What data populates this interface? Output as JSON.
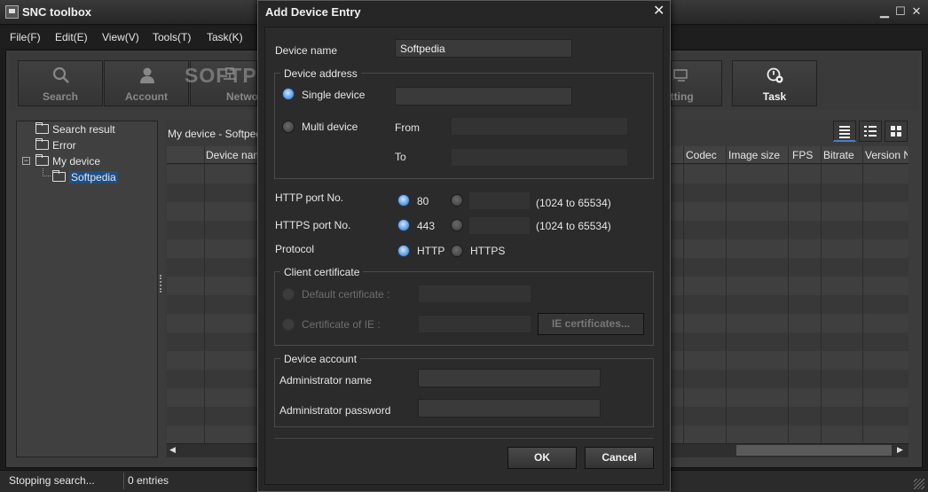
{
  "window": {
    "title": "SNC toolbox",
    "min": "▁",
    "max": "☐",
    "close": "✕"
  },
  "menu": [
    "File(F)",
    "Edit(E)",
    "View(V)",
    "Tools(T)",
    "Task(K)"
  ],
  "toolbar": {
    "search": "Search",
    "account": "Account",
    "network": "Network",
    "setting": "Setting",
    "task": "Task",
    "watermark": "SOFTPEDIA"
  },
  "tree": {
    "search_result": "Search result",
    "error": "Error",
    "my_device": "My device",
    "softpedia": "Softpedia",
    "expander": "−"
  },
  "breadcrumb": "My device - Softpedia",
  "columns": {
    "device_name": "Device name",
    "codec": "Codec",
    "image_size": "Image size",
    "fps": "FPS",
    "bitrate": "Bitrate",
    "version": "Version N"
  },
  "status": {
    "left": "Stopping search...",
    "count": "0 entries"
  },
  "dialog": {
    "title": "Add Device Entry",
    "close": "✕",
    "device_name_label": "Device name",
    "device_name_value": "Softpedia",
    "device_address_legend": "Device address",
    "single_device": "Single device",
    "multi_device": "Multi device",
    "from": "From",
    "to": "To",
    "http_port_label": "HTTP port No.",
    "http_port_default": "80",
    "http_port_range": "(1024 to 65534)",
    "https_port_label": "HTTPS port No.",
    "https_port_default": "443",
    "https_port_range": "(1024 to 65534)",
    "protocol_label": "Protocol",
    "protocol_http": "HTTP",
    "protocol_https": "HTTPS",
    "client_cert_legend": "Client certificate",
    "default_cert": "Default certificate :",
    "cert_ie": "Certificate of IE :",
    "ie_certs_button": "IE certificates...",
    "account_legend": "Device account",
    "admin_name": "Administrator name",
    "admin_password": "Administrator password",
    "ok": "OK",
    "cancel": "Cancel"
  }
}
